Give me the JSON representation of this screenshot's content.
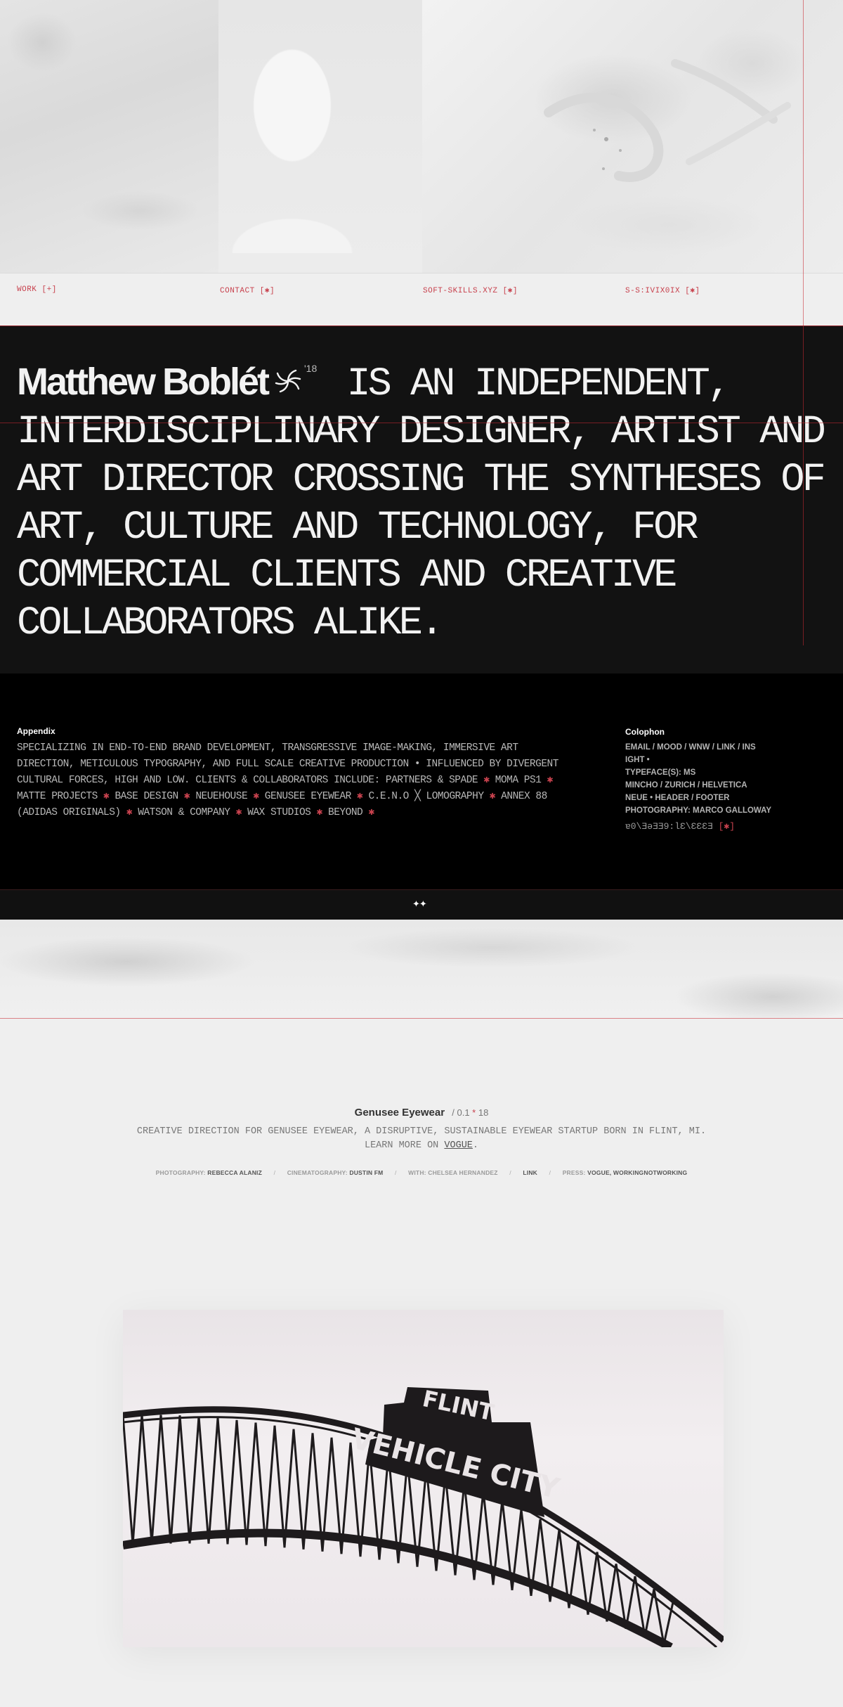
{
  "nav": {
    "links": [
      {
        "label": "WORK [+]"
      },
      {
        "label": "CONTACT [✱]"
      },
      {
        "label": "SOFT-SKILLS.XYZ [✱]"
      },
      {
        "label": "S-S:IVIX0IX [✱]"
      }
    ]
  },
  "intro": {
    "name": "Matthew Boblét",
    "year_sup": "'18",
    "statement": "IS AN INDEPENDENT, INTERDISCIPLINARY DESIGNER, ARTIST AND ART DIRECTOR CROSSING THE SYNTHESES OF ART, CULTURE AND TECHNOLOGY, FOR COMMERCIAL CLIENTS AND CREATIVE COLLABORATORS ALIKE."
  },
  "appendix": {
    "title": "Appendix",
    "intro": "SPECIALIZING IN END-TO-END BRAND DEVELOPMENT, TRANSGRESSIVE IMAGE-MAKING, IMMERSIVE ART DIRECTION, METICULOUS TYPOGRAPHY, AND FULL SCALE CREATIVE PRODUCTION • INFLUENCED BY DIVERGENT CULTURAL FORCES, HIGH AND LOW. CLIENTS & COLLABORATORS INCLUDE: PARTNERS & SPADE",
    "clients": [
      "MOMA PS1",
      "MATTE PROJECTS",
      "BASE DESIGN",
      "NEUEHOUSE",
      "GENUSEE EYEWEAR",
      "C.E.N.O ╳ LOMOGRAPHY",
      "ANNEX 88 (ADIDAS ORIGINALS)",
      "WATSON & COMPANY",
      "WAX STUDIOS",
      "BEYOND"
    ],
    "separator": "✱"
  },
  "colophon": {
    "title": "Colophon",
    "lines": [
      "EMAIL / MOOD / WNW / LINK / INS",
      "IGHT •",
      "TYPEFACE(S): MS",
      "MINCHO / ZURICH / HELVETICA",
      "NEUE • HEADER / FOOTER",
      "PHOTOGRAPHY: MARCO GALLOWAY"
    ],
    "version_text": "ɐ0\\ƎǝƎƎ9:ƖƐ\\ƐƐƐƎ",
    "version_badge": "[✱]"
  },
  "footer_toggle": {
    "icon": "diamond-pair-icon",
    "glyph": "✦✦"
  },
  "project": {
    "name": "Genusee Eyewear",
    "meta": "/ 0.1",
    "meta_star": "*",
    "meta_year": "18",
    "description": "CREATIVE DIRECTION FOR GENUSEE EYEWEAR, A DISRUPTIVE, SUSTAINABLE EYEWEAR STARTUP BORN IN FLINT, MI.",
    "learn_more_prefix": "LEARN MORE ON",
    "learn_more_link": "VOGUE",
    "credits": [
      {
        "label": "PHOTOGRAPHY:",
        "value": "REBECCA ALANIZ"
      },
      {
        "label": "CINEMATOGRAPHY:",
        "value": "DUSTIN FM"
      },
      {
        "label": "WITH: CHELSEA HERNANDEZ",
        "value": ""
      },
      {
        "label": "",
        "value": "LINK"
      },
      {
        "label": "PRESS:",
        "value": "VOGUE, WORKINGNOTWORKING"
      }
    ],
    "credit_separator": "/",
    "image": {
      "sign_top": "FLINT",
      "sign_bottom": "VEHICLE CITY"
    }
  },
  "colors": {
    "accent": "#c8424e",
    "dark": "#121212",
    "black": "#000000",
    "bg": "#efefef"
  }
}
